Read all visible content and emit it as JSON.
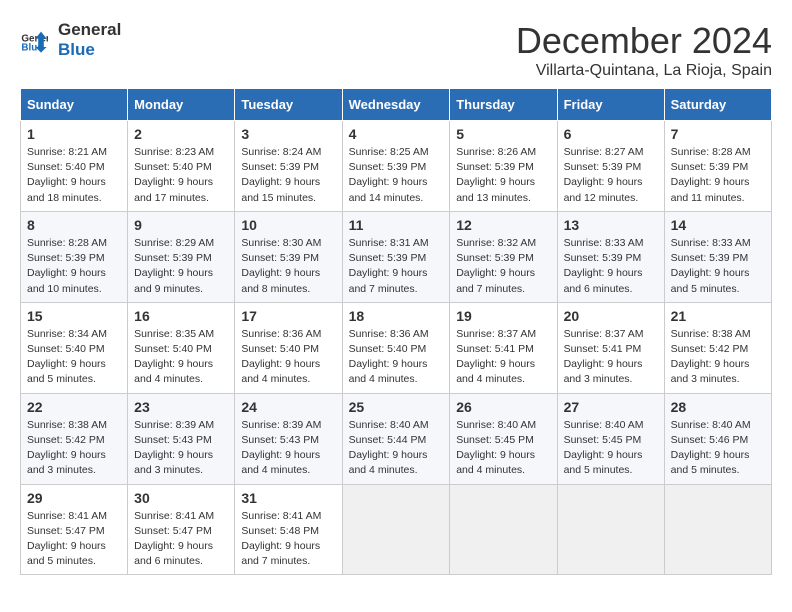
{
  "header": {
    "logo_line1": "General",
    "logo_line2": "Blue",
    "month_title": "December 2024",
    "location": "Villarta-Quintana, La Rioja, Spain"
  },
  "weekdays": [
    "Sunday",
    "Monday",
    "Tuesday",
    "Wednesday",
    "Thursday",
    "Friday",
    "Saturday"
  ],
  "weeks": [
    [
      {
        "day": "1",
        "sunrise": "8:21 AM",
        "sunset": "5:40 PM",
        "daylight": "9 hours and 18 minutes."
      },
      {
        "day": "2",
        "sunrise": "8:23 AM",
        "sunset": "5:40 PM",
        "daylight": "9 hours and 17 minutes."
      },
      {
        "day": "3",
        "sunrise": "8:24 AM",
        "sunset": "5:39 PM",
        "daylight": "9 hours and 15 minutes."
      },
      {
        "day": "4",
        "sunrise": "8:25 AM",
        "sunset": "5:39 PM",
        "daylight": "9 hours and 14 minutes."
      },
      {
        "day": "5",
        "sunrise": "8:26 AM",
        "sunset": "5:39 PM",
        "daylight": "9 hours and 13 minutes."
      },
      {
        "day": "6",
        "sunrise": "8:27 AM",
        "sunset": "5:39 PM",
        "daylight": "9 hours and 12 minutes."
      },
      {
        "day": "7",
        "sunrise": "8:28 AM",
        "sunset": "5:39 PM",
        "daylight": "9 hours and 11 minutes."
      }
    ],
    [
      {
        "day": "8",
        "sunrise": "8:28 AM",
        "sunset": "5:39 PM",
        "daylight": "9 hours and 10 minutes."
      },
      {
        "day": "9",
        "sunrise": "8:29 AM",
        "sunset": "5:39 PM",
        "daylight": "9 hours and 9 minutes."
      },
      {
        "day": "10",
        "sunrise": "8:30 AM",
        "sunset": "5:39 PM",
        "daylight": "9 hours and 8 minutes."
      },
      {
        "day": "11",
        "sunrise": "8:31 AM",
        "sunset": "5:39 PM",
        "daylight": "9 hours and 7 minutes."
      },
      {
        "day": "12",
        "sunrise": "8:32 AM",
        "sunset": "5:39 PM",
        "daylight": "9 hours and 7 minutes."
      },
      {
        "day": "13",
        "sunrise": "8:33 AM",
        "sunset": "5:39 PM",
        "daylight": "9 hours and 6 minutes."
      },
      {
        "day": "14",
        "sunrise": "8:33 AM",
        "sunset": "5:39 PM",
        "daylight": "9 hours and 5 minutes."
      }
    ],
    [
      {
        "day": "15",
        "sunrise": "8:34 AM",
        "sunset": "5:40 PM",
        "daylight": "9 hours and 5 minutes."
      },
      {
        "day": "16",
        "sunrise": "8:35 AM",
        "sunset": "5:40 PM",
        "daylight": "9 hours and 4 minutes."
      },
      {
        "day": "17",
        "sunrise": "8:36 AM",
        "sunset": "5:40 PM",
        "daylight": "9 hours and 4 minutes."
      },
      {
        "day": "18",
        "sunrise": "8:36 AM",
        "sunset": "5:40 PM",
        "daylight": "9 hours and 4 minutes."
      },
      {
        "day": "19",
        "sunrise": "8:37 AM",
        "sunset": "5:41 PM",
        "daylight": "9 hours and 4 minutes."
      },
      {
        "day": "20",
        "sunrise": "8:37 AM",
        "sunset": "5:41 PM",
        "daylight": "9 hours and 3 minutes."
      },
      {
        "day": "21",
        "sunrise": "8:38 AM",
        "sunset": "5:42 PM",
        "daylight": "9 hours and 3 minutes."
      }
    ],
    [
      {
        "day": "22",
        "sunrise": "8:38 AM",
        "sunset": "5:42 PM",
        "daylight": "9 hours and 3 minutes."
      },
      {
        "day": "23",
        "sunrise": "8:39 AM",
        "sunset": "5:43 PM",
        "daylight": "9 hours and 3 minutes."
      },
      {
        "day": "24",
        "sunrise": "8:39 AM",
        "sunset": "5:43 PM",
        "daylight": "9 hours and 4 minutes."
      },
      {
        "day": "25",
        "sunrise": "8:40 AM",
        "sunset": "5:44 PM",
        "daylight": "9 hours and 4 minutes."
      },
      {
        "day": "26",
        "sunrise": "8:40 AM",
        "sunset": "5:45 PM",
        "daylight": "9 hours and 4 minutes."
      },
      {
        "day": "27",
        "sunrise": "8:40 AM",
        "sunset": "5:45 PM",
        "daylight": "9 hours and 5 minutes."
      },
      {
        "day": "28",
        "sunrise": "8:40 AM",
        "sunset": "5:46 PM",
        "daylight": "9 hours and 5 minutes."
      }
    ],
    [
      {
        "day": "29",
        "sunrise": "8:41 AM",
        "sunset": "5:47 PM",
        "daylight": "9 hours and 5 minutes."
      },
      {
        "day": "30",
        "sunrise": "8:41 AM",
        "sunset": "5:47 PM",
        "daylight": "9 hours and 6 minutes."
      },
      {
        "day": "31",
        "sunrise": "8:41 AM",
        "sunset": "5:48 PM",
        "daylight": "9 hours and 7 minutes."
      },
      null,
      null,
      null,
      null
    ]
  ],
  "labels": {
    "sunrise": "Sunrise:",
    "sunset": "Sunset:",
    "daylight": "Daylight:"
  }
}
